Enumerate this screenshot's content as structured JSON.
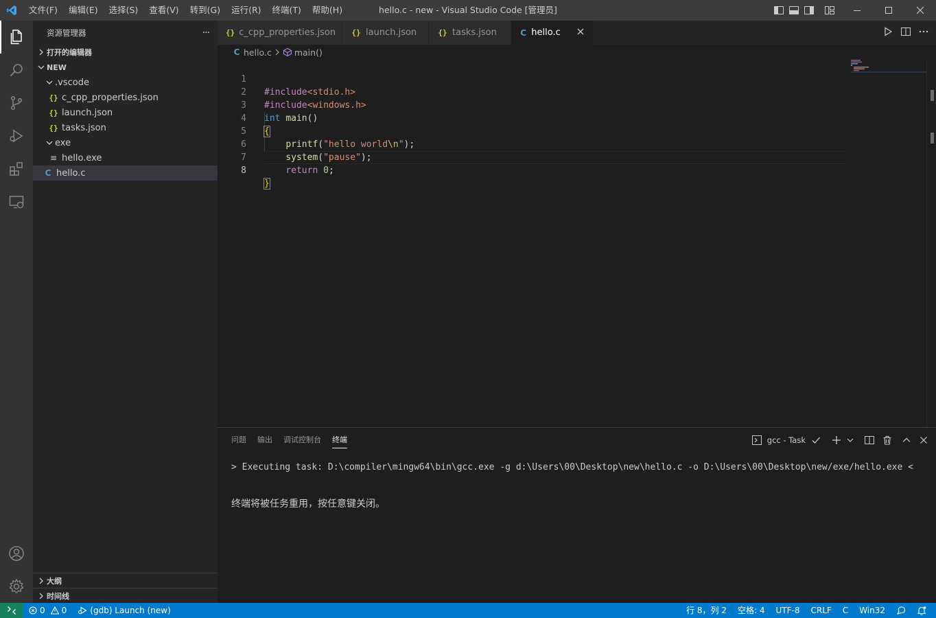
{
  "window": {
    "title": "hello.c - new - Visual Studio Code [管理员]",
    "menu": [
      "文件(F)",
      "编辑(E)",
      "选择(S)",
      "查看(V)",
      "转到(G)",
      "运行(R)",
      "终端(T)",
      "帮助(H)"
    ]
  },
  "activity_bar": {
    "items": [
      "files-icon",
      "search-icon",
      "source-control-icon",
      "run-debug-icon",
      "extensions-icon",
      "remote-explorer-icon"
    ],
    "bottom": [
      "account-icon",
      "manage-gear-icon"
    ]
  },
  "sidebar": {
    "title": "资源管理器",
    "more": "···",
    "open_editors": "打开的编辑器",
    "folder": "NEW",
    "tree": [
      {
        "label": ".vscode",
        "type": "folder",
        "depth": 1
      },
      {
        "label": "c_cpp_properties.json",
        "type": "json",
        "depth": 2
      },
      {
        "label": "launch.json",
        "type": "json",
        "depth": 2
      },
      {
        "label": "tasks.json",
        "type": "json",
        "depth": 2
      },
      {
        "label": "exe",
        "type": "folder",
        "depth": 1
      },
      {
        "label": "hello.exe",
        "type": "exe",
        "depth": 2
      },
      {
        "label": "hello.c",
        "type": "c",
        "depth": 1
      }
    ],
    "outline": "大纲",
    "timeline": "时间线"
  },
  "tabs": [
    {
      "label": "c_cpp_properties.json",
      "type": "json"
    },
    {
      "label": "launch.json",
      "type": "json"
    },
    {
      "label": "tasks.json",
      "type": "json"
    },
    {
      "label": "hello.c",
      "type": "c"
    }
  ],
  "breadcrumb": {
    "file": "hello.c",
    "symbol": "main()"
  },
  "editor": {
    "line_numbers": [
      "1",
      "2",
      "3",
      "4",
      "5",
      "6",
      "7",
      "8"
    ],
    "code": {
      "l1_dir": "#include",
      "l1_hdr": "<stdio.h>",
      "l2_dir": "#include",
      "l2_hdr": "<windows.h>",
      "l3_kw": "int",
      "l3_fn": "main",
      "l3_paren": "()",
      "l4_brace": "{",
      "l5_fn": "printf",
      "l5_open": "(",
      "l5_str": "\"hello world",
      "l5_esc": "\\n",
      "l5_strend": "\"",
      "l5_close": ");",
      "l6_fn": "system",
      "l6_open": "(",
      "l6_str": "\"pause\"",
      "l6_close": ");",
      "l7_kw": "return",
      "l7_num": "0",
      "l7_semi": ";",
      "l8_brace": "}"
    }
  },
  "panel": {
    "tabs": [
      "问题",
      "输出",
      "调试控制台",
      "终端"
    ],
    "terminal_name": "gcc - Task",
    "terminal": {
      "task_line": "> Executing task: D:\\compiler\\mingw64\\bin\\gcc.exe -g d:\\Users\\00\\Desktop\\new\\hello.c -o D:\\Users\\00\\Desktop\\new/exe/hello.exe <",
      "message": "终端将被任务重用，按任意键关闭。"
    }
  },
  "status": {
    "errors": "0",
    "warnings": "0",
    "debug_config": "(gdb) Launch (new)",
    "position": "行 8，列 2",
    "spaces": "空格: 4",
    "encoding": "UTF-8",
    "eol": "CRLF",
    "language": "C",
    "platform": "Win32"
  },
  "colors": {
    "statusbar": "#007acc",
    "remote": "#16825d",
    "activitybar": "#333333",
    "sidebar": "#252526",
    "editor": "#1e1e1e"
  }
}
